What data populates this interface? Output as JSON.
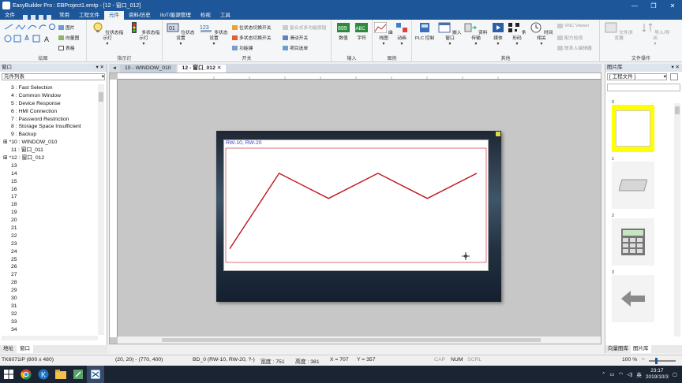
{
  "window": {
    "title": "EasyBuilder Pro : EBProject1.emtp - [12 - 窗口_012]",
    "minimize": "—",
    "maximize": "❐",
    "close": "✕"
  },
  "menu": {
    "items": [
      "文件",
      "常用",
      "工程文件",
      "元件",
      "资料/历史",
      "IIoT/能源管理",
      "检视",
      "工具"
    ],
    "active": "元件"
  },
  "ribbon": {
    "draw_group": {
      "label": "绘图",
      "picture": "图片",
      "vector": "向量图",
      "table": "表格"
    },
    "indicator_group": {
      "label": "指示灯",
      "bit_lamp": "位状态指示灯",
      "multi_lamp": "多状态指示灯"
    },
    "switch_group": {
      "label": "开关",
      "bit_set": "位状态设置",
      "word_set": "多状态设置",
      "bit_toggle": "位状态切换开关",
      "multi_toggle": "多状态切换开关",
      "func_key": "功能键",
      "combo_btn": "复合式多功能按钮",
      "slide_sw": "滑动开关",
      "item_list": "项目选单",
      "word_icon_text": "123"
    },
    "input_group": {
      "label": "输入",
      "numeric": "数值",
      "character": "字符",
      "numeric_icon_text": "899",
      "char_icon_text": "ABC"
    },
    "chart_group": {
      "label": "图例",
      "trend": "曲线图",
      "animation": "动画"
    },
    "other_group": {
      "label": "其他",
      "plc": "PLC 控制",
      "popup": "嵌入窗口",
      "transfer": "资料传输",
      "media": "媒体",
      "barcode": "条形码",
      "time": "时间相关",
      "vnc": "VNC Viewer",
      "recipe_view": "配方检视",
      "contact_edit": "联系人编辑器"
    },
    "file_group": {
      "label": "文件操作",
      "browser": "文件浏览器",
      "import_export": "导入/导出"
    }
  },
  "left_panel": {
    "header": "窗口",
    "header_ctl": "▾ ✕",
    "dropdown": "元件列表",
    "tree": [
      "3 : Fast Selection",
      "4 : Common Window",
      "5 : Device Response",
      "6 : HMI Connection",
      "7 : Password Restriction",
      "8 : Storage Space Insufficient",
      "9 : Backup",
      "*10 : WINDOW_010",
      "11 : 窗口_011",
      "*12 : 窗口_012",
      "13",
      "14",
      "15",
      "16",
      "17",
      "18",
      "19",
      "20",
      "21",
      "22",
      "23",
      "24",
      "25",
      "26",
      "27",
      "28",
      "29",
      "30",
      "31",
      "32",
      "33",
      "34"
    ],
    "tabs": [
      "地址",
      "窗口"
    ],
    "active_tab": "窗口"
  },
  "doc_tabs": {
    "items": [
      "10 - WINDOW_010",
      "12 - 窗口_012"
    ],
    "active": "12 - 窗口_012",
    "close": "✕"
  },
  "canvas": {
    "trend_address": "RW-10, RW-20",
    "line_color": "#c0141e"
  },
  "right_panel": {
    "header": "图片库",
    "header_ctl": "▾ ✕",
    "dropdown": "[ 工程文件 ]",
    "items": [
      "0",
      "1",
      "2",
      "3"
    ],
    "tabs": [
      "向量图库",
      "图片库"
    ],
    "active_tab": "图片库"
  },
  "status": {
    "model": "TK6071iP (800 x 480)",
    "coords": "(20, 20) - (770, 400)",
    "object": "BD_0 (RW-10, RW-20, ?-)",
    "width": "宽度 : 751",
    "height": "高度 : 381",
    "x": "X = 707",
    "y": "Y = 357",
    "caps": "CAP",
    "num": "NUM",
    "scrl": "SCRL",
    "zoom": "100 %"
  },
  "taskbar": {
    "time": "23:17",
    "date": "2019/10/3",
    "ime": "英"
  },
  "chart_data": {
    "type": "line",
    "x": [
      0,
      1,
      2,
      3,
      4,
      5
    ],
    "series": [
      {
        "values": [
          12,
          78,
          56,
          78,
          56,
          78
        ]
      }
    ],
    "ylim": [
      0,
      100
    ],
    "title": "",
    "xlabel": "",
    "ylabel": ""
  }
}
